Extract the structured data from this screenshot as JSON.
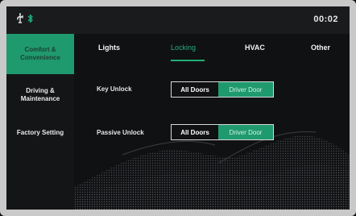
{
  "status_bar": {
    "time": "00:02",
    "icons": [
      "usb-icon",
      "bluetooth-icon"
    ]
  },
  "sidebar": {
    "items": [
      {
        "label": "Comfort & Convenience",
        "active": true
      },
      {
        "label": "Driving & Maintenance",
        "active": false
      },
      {
        "label": "Factory Setting",
        "active": false
      }
    ]
  },
  "tabs": [
    {
      "label": "Lights",
      "active": false
    },
    {
      "label": "Locking",
      "active": true
    },
    {
      "label": "HVAC",
      "active": false
    },
    {
      "label": "Other",
      "active": false
    }
  ],
  "settings": [
    {
      "label": "Key Unlock",
      "options": [
        "All Doors",
        "Driver Door"
      ],
      "selected": "Driver Door"
    },
    {
      "label": "Passive Unlock",
      "options": [
        "All Doors",
        "Driver Door"
      ],
      "selected": "Driver Door"
    }
  ],
  "colors": {
    "accent": "#1f9a6e",
    "accent_text": "#1fae7a",
    "background": "#101113",
    "bezel": "#c9c9c9"
  }
}
